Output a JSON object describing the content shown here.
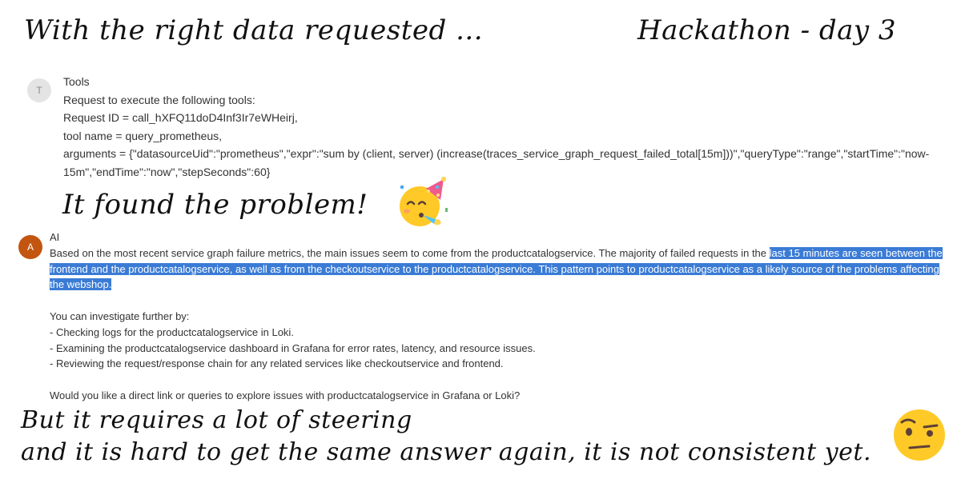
{
  "headline_left": "With the right data requested ...",
  "headline_right": "Hackathon - day 3",
  "tools_message": {
    "avatar_initial": "T",
    "sender": "Tools",
    "lines": [
      "Request to execute the following tools:",
      "Request ID = call_hXFQ11doD4Inf3Ir7eWHeirj,",
      "tool name = query_prometheus,",
      "arguments = {\"datasourceUid\":\"prometheus\",\"expr\":\"sum by (client, server) (increase(traces_service_graph_request_failed_total[15m]))\",\"queryType\":\"range\",\"startTime\":\"now-15m\",\"endTime\":\"now\",\"stepSeconds\":60}"
    ]
  },
  "found_text": "It found the problem!",
  "ai_message": {
    "avatar_initial": "A",
    "sender": "AI",
    "summary_plain": "Based on the most recent service graph failure metrics, the main issues seem to come from the productcatalogservice. The majority of failed requests in the ",
    "summary_highlighted": "last 15 minutes are seen between the frontend and the productcatalogservice, as well as from the checkoutservice to the productcatalogservice. This pattern points to productcatalogservice as a likely source of the problems affecting the webshop.",
    "investigate_intro": "You can investigate further by:",
    "bullets": [
      "- Checking logs for the productcatalogservice in Loki.",
      "- Examining the productcatalogservice dashboard in Grafana for error rates, latency, and resource issues.",
      "- Reviewing the request/response chain for any related services like checkoutservice and frontend."
    ],
    "question": "Would you like a direct link or queries to explore issues with productcatalogservice in Grafana or Loki?"
  },
  "footer": {
    "line1": "But it requires a lot of steering",
    "line2": "and it is hard to get the same answer again, it is not consistent yet."
  },
  "icons": {
    "party": "partying-face-emoji",
    "skeptical": "raised-eyebrow-face-emoji"
  },
  "colors": {
    "selection": "#3a7bd5",
    "ai_avatar": "#c2550f",
    "tools_avatar": "#e4e4e4"
  }
}
